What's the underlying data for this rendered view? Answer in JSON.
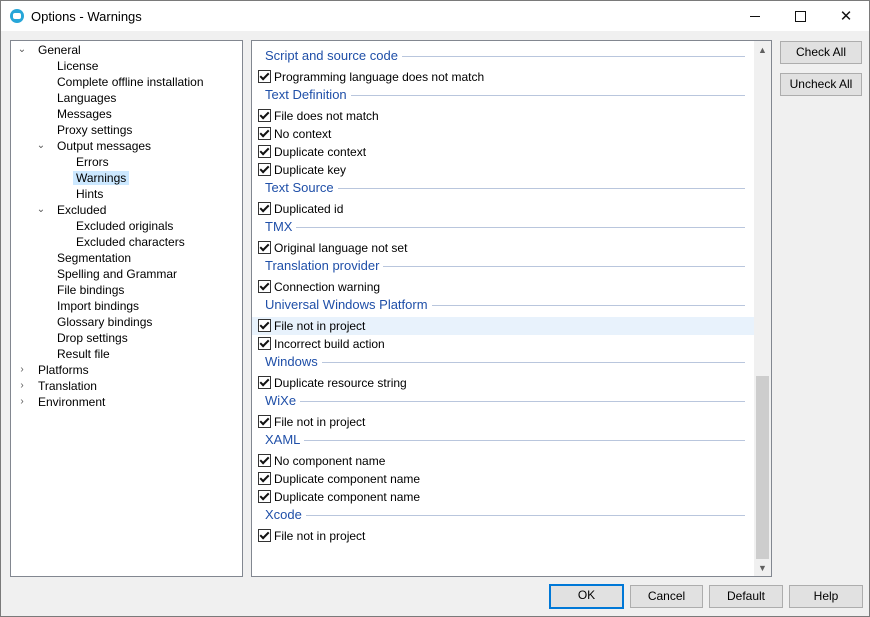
{
  "window": {
    "title": "Options - Warnings",
    "minimize": "",
    "maximize": "",
    "close": "✕"
  },
  "tree": {
    "items": [
      {
        "label": "General",
        "level": 0,
        "expander": "down"
      },
      {
        "label": "License",
        "level": 1
      },
      {
        "label": "Complete offline installation",
        "level": 1
      },
      {
        "label": "Languages",
        "level": 1
      },
      {
        "label": "Messages",
        "level": 1
      },
      {
        "label": "Proxy settings",
        "level": 1
      },
      {
        "label": "Output messages",
        "level": 1,
        "expander": "down"
      },
      {
        "label": "Errors",
        "level": 2
      },
      {
        "label": "Warnings",
        "level": 2,
        "selected": true
      },
      {
        "label": "Hints",
        "level": 2
      },
      {
        "label": "Excluded",
        "level": 1,
        "expander": "down"
      },
      {
        "label": "Excluded originals",
        "level": 2
      },
      {
        "label": "Excluded characters",
        "level": 2
      },
      {
        "label": "Segmentation",
        "level": 1
      },
      {
        "label": "Spelling and Grammar",
        "level": 1
      },
      {
        "label": "File bindings",
        "level": 1
      },
      {
        "label": "Import bindings",
        "level": 1
      },
      {
        "label": "Glossary bindings",
        "level": 1
      },
      {
        "label": "Drop settings",
        "level": 1
      },
      {
        "label": "Result file",
        "level": 1
      },
      {
        "label": "Platforms",
        "level": 0,
        "expander": "right"
      },
      {
        "label": "Translation",
        "level": 0,
        "expander": "right"
      },
      {
        "label": "Environment",
        "level": 0,
        "expander": "right"
      }
    ]
  },
  "warnings": {
    "rows": [
      {
        "type": "group",
        "label": "Script and source code"
      },
      {
        "type": "option",
        "label": "Programming language does not match",
        "checked": true
      },
      {
        "type": "group",
        "label": "Text Definition"
      },
      {
        "type": "option",
        "label": "File does not match",
        "checked": true
      },
      {
        "type": "option",
        "label": "No context",
        "checked": true
      },
      {
        "type": "option",
        "label": "Duplicate context",
        "checked": true
      },
      {
        "type": "option",
        "label": "Duplicate key",
        "checked": true
      },
      {
        "type": "group",
        "label": "Text Source"
      },
      {
        "type": "option",
        "label": "Duplicated id",
        "checked": true
      },
      {
        "type": "group",
        "label": "TMX"
      },
      {
        "type": "option",
        "label": "Original language not set",
        "checked": true
      },
      {
        "type": "group",
        "label": "Translation provider"
      },
      {
        "type": "option",
        "label": "Connection warning",
        "checked": true
      },
      {
        "type": "group",
        "label": "Universal Windows Platform"
      },
      {
        "type": "option",
        "label": "File not in project",
        "checked": true,
        "highlight": true
      },
      {
        "type": "option",
        "label": "Incorrect build action",
        "checked": true
      },
      {
        "type": "group",
        "label": "Windows"
      },
      {
        "type": "option",
        "label": "Duplicate resource string",
        "checked": true
      },
      {
        "type": "group",
        "label": "WiXe"
      },
      {
        "type": "option",
        "label": "File not in project",
        "checked": true
      },
      {
        "type": "group",
        "label": "XAML"
      },
      {
        "type": "option",
        "label": "No component name",
        "checked": true
      },
      {
        "type": "option",
        "label": "Duplicate component name",
        "checked": true
      },
      {
        "type": "option",
        "label": "Duplicate component name",
        "checked": true
      },
      {
        "type": "group",
        "label": "Xcode"
      },
      {
        "type": "option",
        "label": "File not in project",
        "checked": true
      }
    ],
    "scroll_up": "▲",
    "scroll_down": "▼",
    "scroll_position": 1.0
  },
  "side_buttons": {
    "check_all": "Check All",
    "uncheck_all": "Uncheck All"
  },
  "footer": {
    "ok": "OK",
    "cancel": "Cancel",
    "default": "Default",
    "help": "Help"
  }
}
